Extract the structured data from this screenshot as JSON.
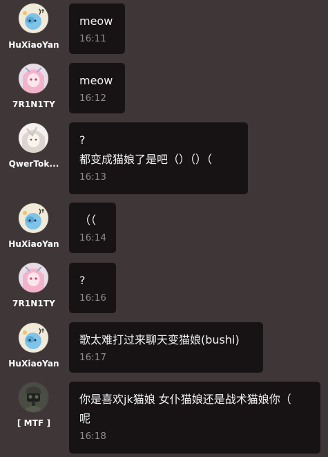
{
  "messages": [
    {
      "user": "HuXiaoYan",
      "avatar": "anime-girl-blue-avatar",
      "text": "meow",
      "time": "16:11"
    },
    {
      "user": "7R1N1TY",
      "avatar": "anime-girl-pink-avatar",
      "text": "meow",
      "time": "16:12"
    },
    {
      "user": "QwerTok...",
      "avatar": "anime-girl-white-hair-avatar",
      "text": "?\n都变成猫娘了是吧（）（）（",
      "time": "16:13"
    },
    {
      "user": "HuXiaoYan",
      "avatar": "anime-girl-blue-avatar",
      "text": "（（",
      "time": "16:14"
    },
    {
      "user": "7R1N1TY",
      "avatar": "anime-girl-pink-avatar",
      "text": "?",
      "time": "16:16"
    },
    {
      "user": "HuXiaoYan",
      "avatar": "anime-girl-blue-avatar",
      "text": "歌太难打过来聊天变猫娘(bushi)",
      "time": "16:17"
    },
    {
      "user": "[ MTF ]",
      "avatar": "soldier-avatar",
      "text": "你是喜欢jk猫娘 女仆猫娘还是战术猫娘你（\n呢",
      "time": "16:18"
    }
  ],
  "colors": {
    "background": "#3f3638",
    "bubble": "#171315",
    "text": "#f2f2f2",
    "timestamp": "#8f8c8d",
    "username": "#ffffff"
  }
}
